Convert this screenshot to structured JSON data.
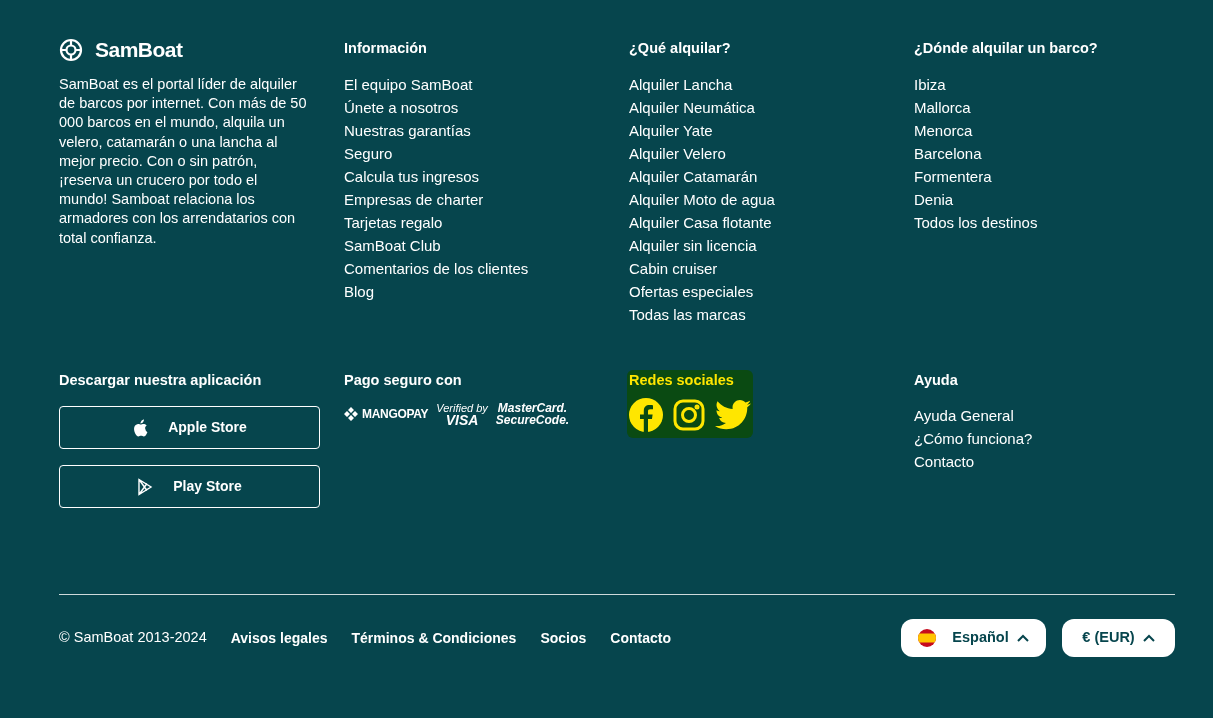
{
  "brand": {
    "name": "SamBoat",
    "description": "SamBoat es el portal líder de alquiler de barcos por internet. Con más de 50 000 barcos en el mundo, alquila un velero, catamarán o una lancha al mejor precio. Con o sin patrón, ¡reserva un crucero por todo el mundo! Samboat relaciona los armadores con los arrendatarios con total confianza."
  },
  "link_columns": [
    {
      "title": "Información",
      "links": [
        "El equipo SamBoat",
        "Únete a nosotros",
        "Nuestras garantías",
        "Seguro",
        "Calcula tus ingresos",
        "Empresas de charter",
        "Tarjetas regalo",
        "SamBoat Club",
        "Comentarios de los clientes",
        "Blog"
      ]
    },
    {
      "title": "¿Qué alquilar?",
      "links": [
        "Alquiler Lancha",
        "Alquiler Neumática",
        "Alquiler Yate",
        "Alquiler Velero",
        "Alquiler Catamarán",
        "Alquiler Moto de agua",
        "Alquiler Casa flotante",
        "Alquiler sin licencia",
        "Cabin cruiser",
        "Ofertas especiales",
        "Todas las marcas"
      ]
    },
    {
      "title": "¿Dónde alquilar un barco?",
      "links": [
        "Ibiza",
        "Mallorca",
        "Menorca",
        "Barcelona",
        "Formentera",
        "Denia",
        "Todos los destinos"
      ]
    }
  ],
  "app": {
    "title": "Descargar nuestra aplicación",
    "buttons": [
      {
        "kind": "apple",
        "label": "Apple Store"
      },
      {
        "kind": "play",
        "label": "Play Store"
      }
    ]
  },
  "payment": {
    "title": "Pago seguro con",
    "logos": [
      {
        "kind": "mangopay",
        "text": "MANGOPAY"
      },
      {
        "kind": "visa",
        "text": "Verified by",
        "text_2": "VISA"
      },
      {
        "kind": "mastercard",
        "text": "MasterCard.",
        "text_2": "SecureCode."
      }
    ]
  },
  "social": {
    "title": "Redes sociales",
    "highlighted": true,
    "icons": [
      {
        "kind": "facebook"
      },
      {
        "kind": "instagram"
      },
      {
        "kind": "twitter"
      }
    ]
  },
  "help": {
    "title": "Ayuda",
    "links": [
      "Ayuda General",
      "¿Cómo funciona?",
      "Contacto"
    ]
  },
  "bottom_bar": {
    "copyright": "© SamBoat 2013-2024",
    "links": [
      "Avisos legales",
      "Términos & Condiciones",
      "Socios",
      "Contacto"
    ],
    "language": "Español",
    "currency": "€ (EUR)"
  }
}
